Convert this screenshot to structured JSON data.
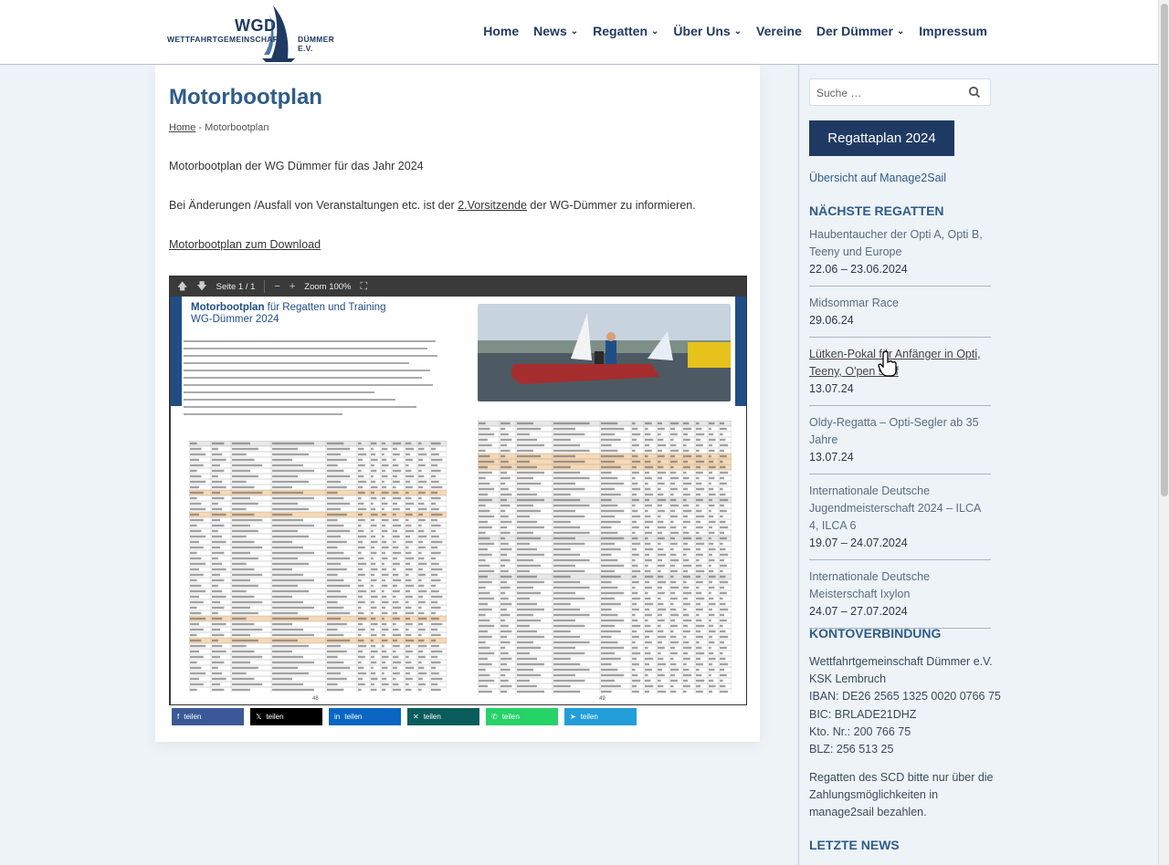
{
  "logo": {
    "abbr": "WGD",
    "line1": "WETTFAHRTGEMEINSCHAFT",
    "line2": "DÜMMER E.V."
  },
  "nav": {
    "items": [
      {
        "label": "Home",
        "dropdown": false
      },
      {
        "label": "News",
        "dropdown": true
      },
      {
        "label": "Regatten",
        "dropdown": true
      },
      {
        "label": "Über Uns",
        "dropdown": true
      },
      {
        "label": "Vereine",
        "dropdown": false
      },
      {
        "label": "Der Dümmer",
        "dropdown": true
      },
      {
        "label": "Impressum",
        "dropdown": false
      }
    ]
  },
  "main": {
    "title": "Motorbootplan",
    "breadcrumb": {
      "home": "Home",
      "separator": " - ",
      "current": "Motorbootplan"
    },
    "intro": "Motorbootplan der WG Dümmer für das Jahr 2024",
    "change_pre": "Bei Änderungen /Ausfall von Veranstaltungen etc. ist der ",
    "change_link": "2.Vorsitzende",
    "change_post": " der WG-Dümmer zu informieren.",
    "download_link": "Motorbootplan zum Download"
  },
  "pdf": {
    "page_label": "Seite 1 / 1",
    "zoom_label": "Zoom 100%",
    "doc_title_bold": "Motorbootplan",
    "doc_title_rest": " für Regatten und Training",
    "doc_subtitle": "WG-Dümmer 2024",
    "page_left": "48",
    "page_right": "49"
  },
  "share": [
    {
      "label": "teilen",
      "network": "facebook",
      "icon": "facebook-icon",
      "color": "#3b5998"
    },
    {
      "label": "teilen",
      "network": "x",
      "icon": "x-icon",
      "color": "#000000"
    },
    {
      "label": "teilen",
      "network": "linkedin",
      "icon": "linkedin-icon",
      "color": "#0a66c2"
    },
    {
      "label": "teilen",
      "network": "xing",
      "icon": "xing-icon",
      "color": "#0a5c5c"
    },
    {
      "label": "teilen",
      "network": "whatsapp",
      "icon": "whatsapp-icon",
      "color": "#25d366"
    },
    {
      "label": "teilen",
      "network": "telegram",
      "icon": "telegram-icon",
      "color": "#229ed9"
    }
  ],
  "sidebar": {
    "search_placeholder": "Suche …",
    "regattaplan_button": "Regattaplan 2024",
    "manage2sail": "Übersicht auf Manage2Sail",
    "next_heading": "NÄCHSTE REGATTEN",
    "regattas": [
      {
        "name": "Haubentaucher der Opti A, Opti B, Teeny und Europe",
        "date": "22.06 – 23.06.2024"
      },
      {
        "name": "Midsommar Race",
        "date": "29.06.24"
      },
      {
        "name": "Lütken-Pokal für Anfänger in Opti, Teeny, O'pen skiff",
        "date": "13.07.24"
      },
      {
        "name": "Oldy-Regatta – Opti-Segler ab 35 Jahre",
        "date": "13.07.24"
      },
      {
        "name": "Internationale Deutsche Jugendmeisterschaft 2024 – ILCA 4, ILCA 6",
        "date": "19.07 – 24.07.2024"
      },
      {
        "name": "Internationale Deutsche Meisterschaft Ixylon",
        "date": "24.07 – 27.07.2024"
      }
    ],
    "konto_heading": "KONTOVERBINDUNG",
    "konto_lines": [
      "Wettfahrtgemeinschaft Dümmer e.V.",
      "KSK Lembruch",
      "IBAN: DE26 2565 1325 0020 0766 75",
      "BIC: BRLADE21DHZ",
      "Kto. Nr.: 200 766 75",
      "BLZ: 256 513 25"
    ],
    "note": "Regatten des SCD bitte nur über die Zahlungsmöglichkeiten in manage2sail bezahlen.",
    "news_heading": "LETZTE NEWS"
  },
  "colors": {
    "primary": "#1f3a62",
    "accent": "#2e5c8a",
    "background": "#eef3f8"
  }
}
